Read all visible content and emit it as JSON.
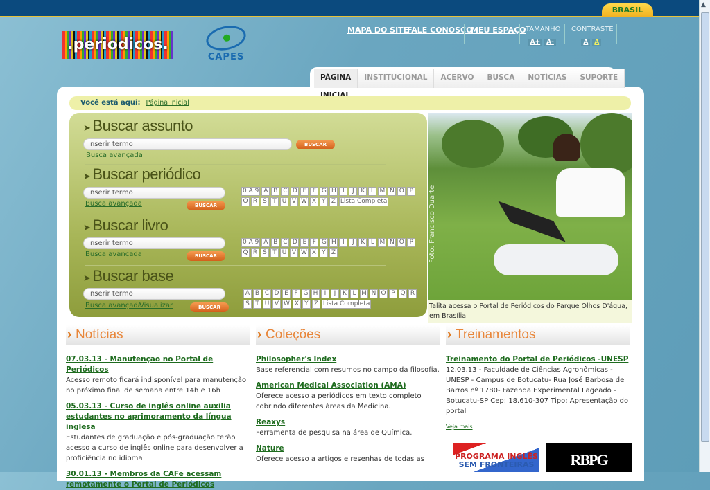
{
  "gov_bar": {
    "label": "BRASIL",
    "color": "#0b4a7e"
  },
  "header": {
    "logo_text": ".periodicos.",
    "capes_text": "CAPES",
    "links": [
      "MAPA DO SITE",
      "FALE CONOSCO",
      "MEU ESPAÇO"
    ],
    "tamanho": {
      "label": "TAMANHO",
      "buttons": [
        "A+",
        "A-"
      ]
    },
    "contraste": {
      "label": "CONTRASTE",
      "buttons": [
        "A",
        "A"
      ]
    }
  },
  "tabs": [
    {
      "label": "PÁGINA INICIAL",
      "active": true
    },
    {
      "label": "INSTITUCIONAL"
    },
    {
      "label": "ACERVO"
    },
    {
      "label": "BUSCA"
    },
    {
      "label": "NOTÍCIAS"
    },
    {
      "label": "SUPORTE"
    }
  ],
  "breadcrumb": {
    "label": "Você está aqui:",
    "current": "Página inicial"
  },
  "search": {
    "assunto": {
      "title": "Buscar assunto",
      "placeholder": "Inserir termo",
      "advanced": "Busca avançada",
      "button": "BUSCAR"
    },
    "periodico": {
      "title": "Buscar periódico",
      "placeholder": "Inserir termo",
      "advanced": "Busca avançada",
      "button": "BUSCAR",
      "letters": [
        "0 A 9",
        "A",
        "B",
        "C",
        "D",
        "E",
        "F",
        "G",
        "H",
        "I",
        "J",
        "K",
        "L",
        "M",
        "N",
        "O",
        "P",
        "Q",
        "R",
        "S",
        "T",
        "U",
        "V",
        "W",
        "X",
        "Y",
        "Z",
        "Lista Completa"
      ]
    },
    "livro": {
      "title": "Buscar livro",
      "placeholder": "Inserir termo",
      "advanced": "Busca avançada",
      "button": "BUSCAR",
      "letters": [
        "0 A 9",
        "A",
        "B",
        "C",
        "D",
        "E",
        "F",
        "G",
        "H",
        "I",
        "J",
        "K",
        "L",
        "M",
        "N",
        "O",
        "P",
        "Q",
        "R",
        "S",
        "T",
        "U",
        "V",
        "W",
        "X",
        "Y",
        "Z"
      ]
    },
    "base": {
      "title": "Buscar base",
      "placeholder": "Inserir termo",
      "advanced": "Busca avançada",
      "visualizar": "Visualizar",
      "button": "BUSCAR",
      "letters": [
        "A",
        "B",
        "C",
        "D",
        "E",
        "F",
        "G",
        "H",
        "I",
        "J",
        "K",
        "L",
        "M",
        "N",
        "O",
        "P",
        "Q",
        "R",
        "S",
        "T",
        "U",
        "V",
        "W",
        "X",
        "Y",
        "Z",
        "Lista Completa"
      ]
    }
  },
  "photo": {
    "credit": "Foto: Francisco Duarte",
    "caption": "Talita acessa o Portal de Periódicos do Parque Olhos D'água, em Brasília"
  },
  "noticias": {
    "title": "Notícias",
    "items": [
      {
        "title": "07.03.13 - Manutenção no Portal de Periódicos",
        "text": "Acesso remoto ficará indisponível para manutenção no próximo final de semana entre 14h e 16h"
      },
      {
        "title": "05.03.13 - Curso de inglês online auxilia estudantes no aprimoramento da língua inglesa",
        "text": "Estudantes de graduação e pós-graduação terão acesso a curso de inglês online para desenvolver a proficiência no idioma"
      },
      {
        "title": "30.01.13 - Membros da CAFe acessam remotamente o Portal de Periódicos",
        "text": ""
      }
    ]
  },
  "colecoes": {
    "title": "Coleções",
    "items": [
      {
        "title": "Philosopher's Index",
        "text": "Base referencial com resumos no campo da filosofia."
      },
      {
        "title": "American Medical Association (AMA)",
        "text": "Oferece acesso a periódicos em texto completo cobrindo diferentes áreas da Medicina."
      },
      {
        "title": "Reaxys",
        "text": "Ferramenta de pesquisa na área de Química."
      },
      {
        "title": "Nature",
        "text": "Oferece acesso a artigos e resenhas de todas as"
      }
    ]
  },
  "treinamentos": {
    "title": "Treinamentos",
    "items": [
      {
        "title": "Treinamento do Portal de Periódicos -UNESP",
        "text": "12.03.13 - Faculdade de Ciências Agronômicas - UNESP - Campus de Botucatu- Rua José Barbosa de Barros nº 1780- Fazenda Experimental Lageado - Botucatu-SP Cep: 18.610-307 Tipo: Apresentação do portal"
      }
    ],
    "more": "Veja mais"
  },
  "banners": {
    "ingles_line1": "PROGRAMA INGLÊS",
    "ingles_line2": "SEM FRONTEIRAS",
    "rbpg": "RBPG"
  }
}
